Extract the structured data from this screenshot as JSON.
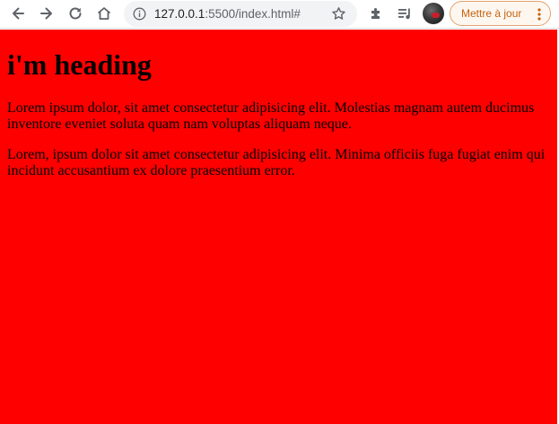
{
  "browser": {
    "url_host": "127.0.0.1",
    "url_rest": ":5500/index.html#",
    "update_button_label": "Mettre à jour",
    "icons": {
      "back": "arrow-left-icon",
      "forward": "arrow-right-icon",
      "reload": "reload-icon",
      "home": "home-icon",
      "site_info": "info-icon",
      "bookmark": "star-icon",
      "extensions": "puzzle-icon",
      "media": "playlist-icon",
      "profile": "avatar",
      "menu": "kebab-menu-icon"
    },
    "colors": {
      "update_accent": "#c5620f"
    }
  },
  "page": {
    "heading": "i'm heading",
    "paragraphs": [
      "Lorem ipsum dolor, sit amet consectetur adipisicing elit. Molestias magnam autem ducimus inventore eveniet soluta quam nam voluptas aliquam neque.",
      "Lorem, ipsum dolor sit amet consectetur adipisicing elit. Minima officiis fuga fugiat enim qui incidunt accusantium ex dolore praesentium error."
    ],
    "background_color": "#ff0000"
  }
}
